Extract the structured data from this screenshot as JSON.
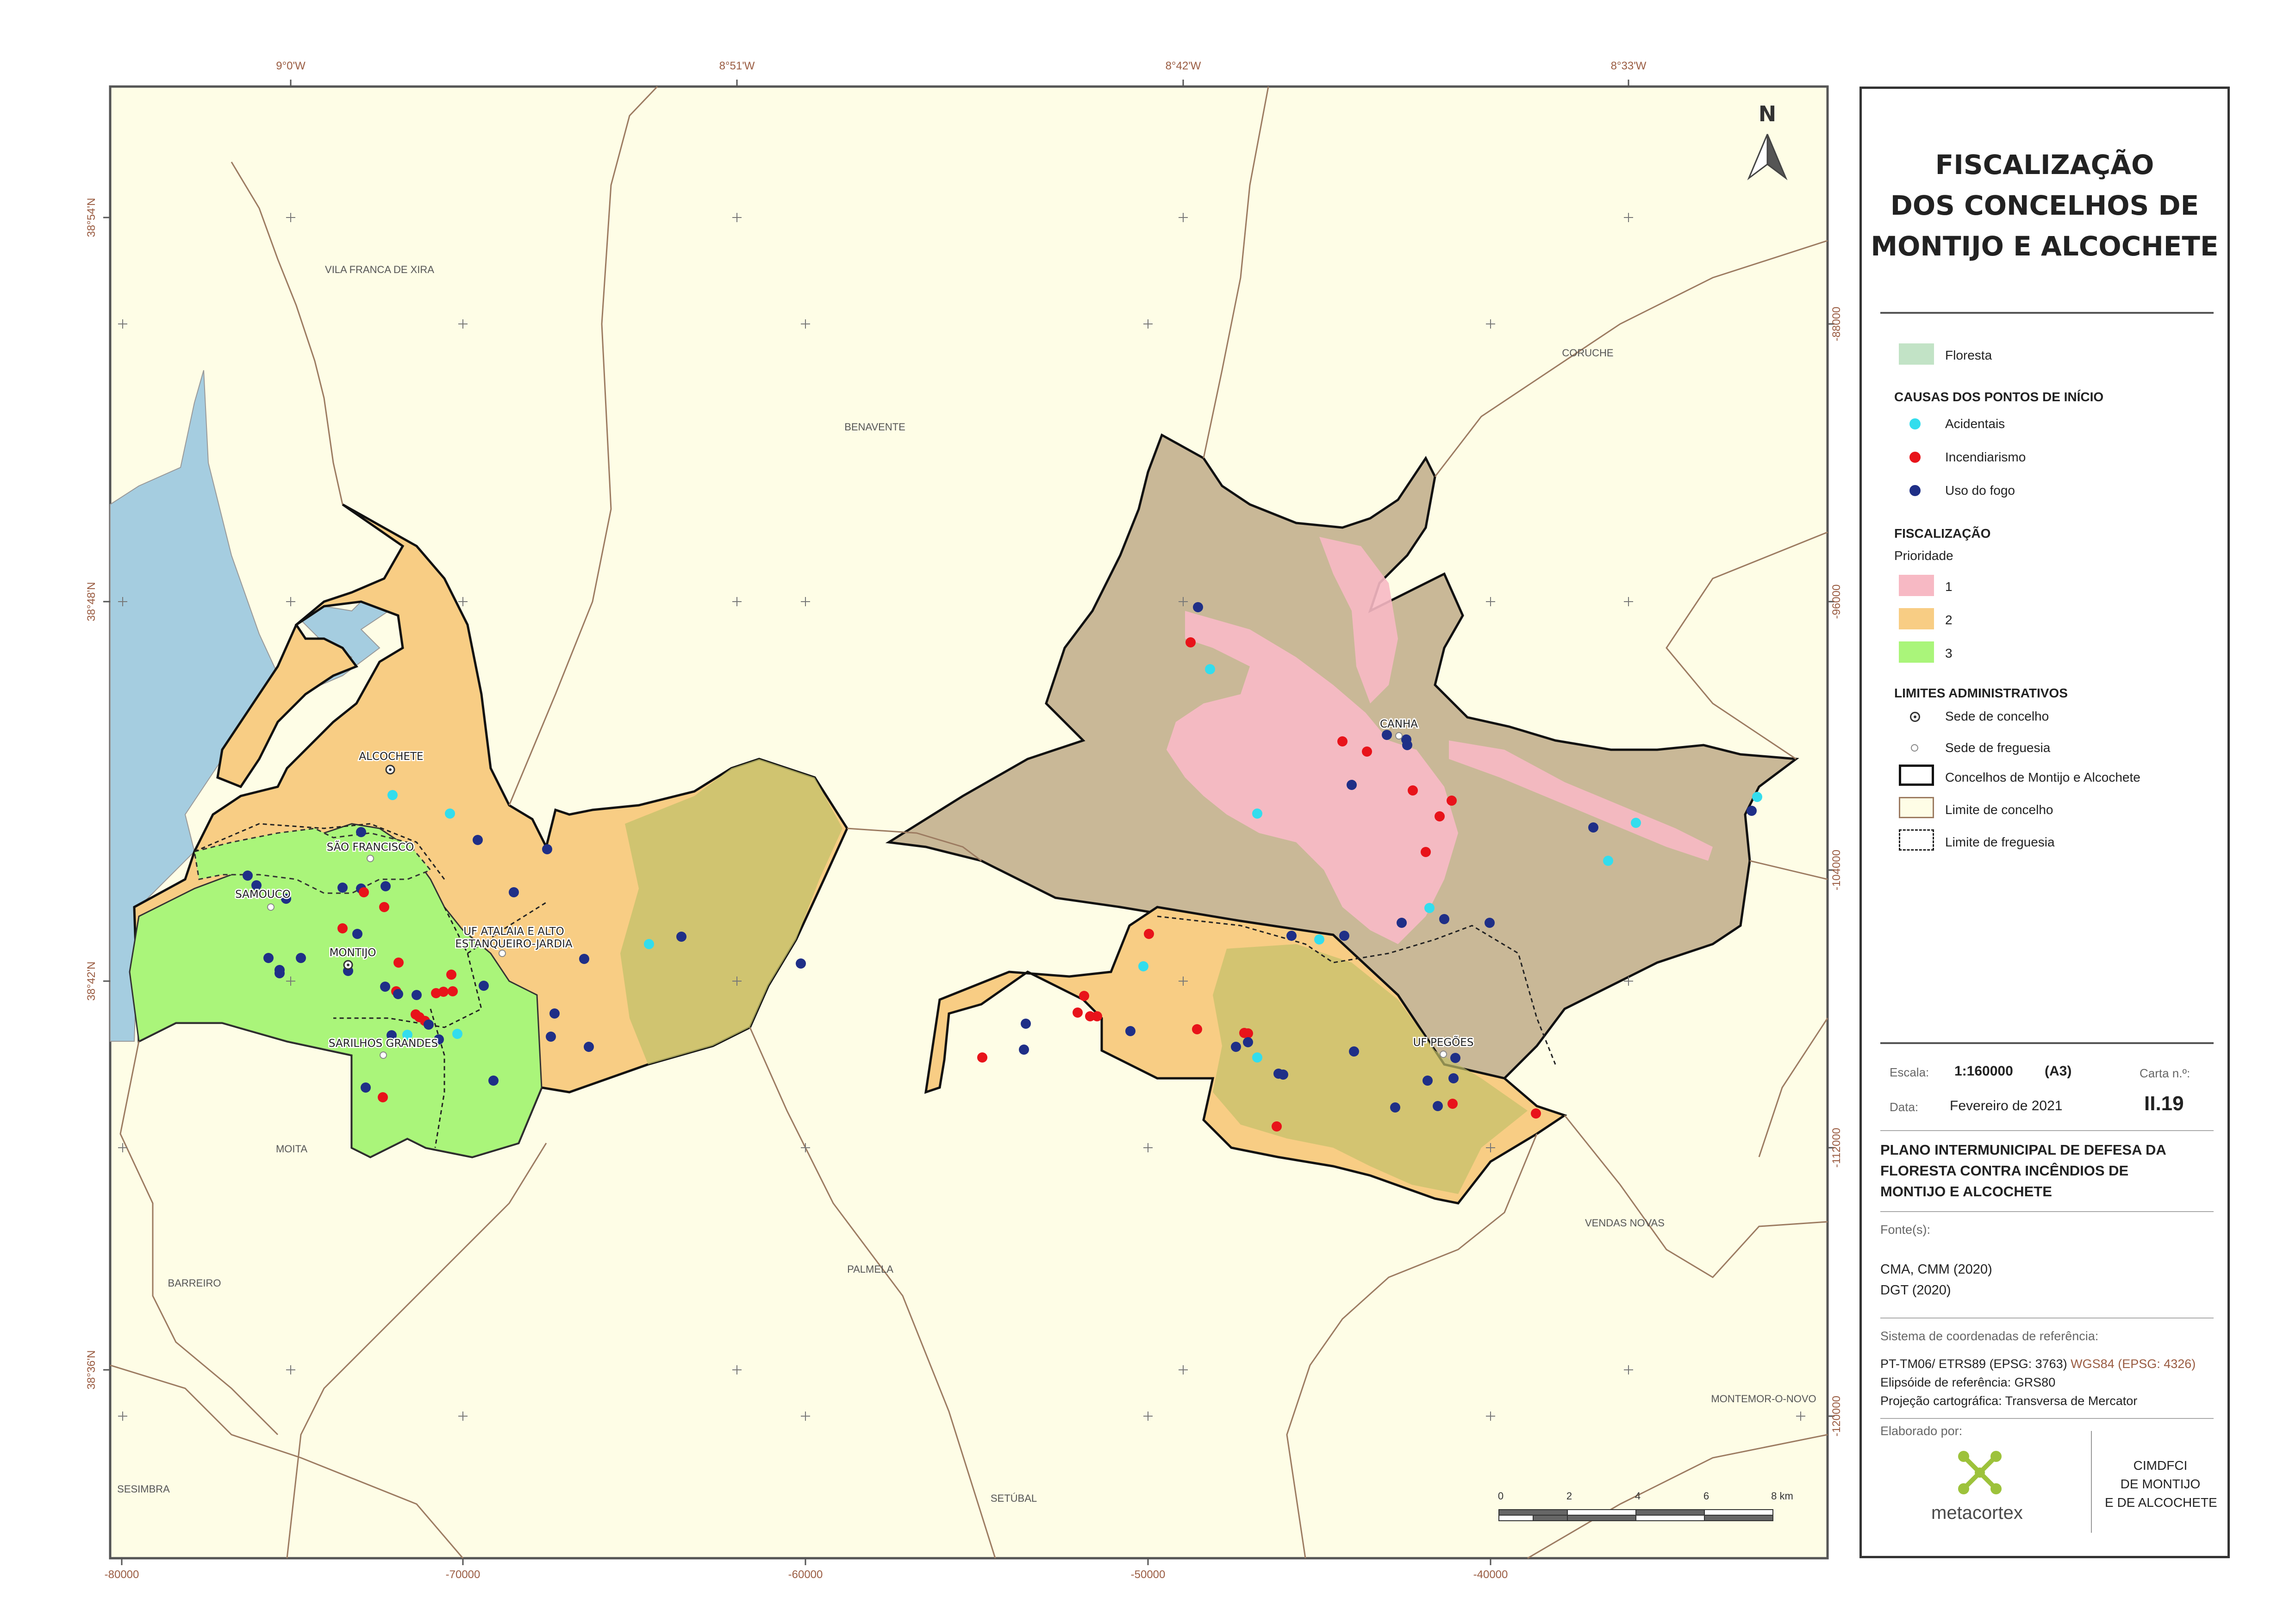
{
  "map": {
    "top_ticks": [
      "9°0'W",
      "8°51'W",
      "8°42'W",
      "8°33'W"
    ],
    "bottom_ticks": [
      "-80000",
      "-70000",
      "-60000",
      "-50000",
      "-40000"
    ],
    "left_ticks": [
      "38°54'N",
      "38°48'N",
      "38°42'N",
      "38°36'N"
    ],
    "right_ticks": [
      "-88000",
      "-96000",
      "-104000",
      "-112000",
      "-120000"
    ],
    "municipalities": [
      "VILA FRANCA DE XIRA",
      "BENAVENTE",
      "CORUCHE",
      "MOITA",
      "PALMELA",
      "VENDAS NOVAS",
      "BARREIRO",
      "MONTEMOR-O-NOVO",
      "SESIMBRA",
      "SETÚBAL"
    ],
    "places": {
      "alcochete": "ALCOCHETE",
      "sao_francisco": "SÃO FRANCISCO",
      "samouco": "SAMOUCO",
      "montijo": "MONTIJO",
      "atalaia_1": "UF ATALAIA E ALTO",
      "atalaia_2": "ESTANQUEIRO-JARDIA",
      "sarilhos": "SARILHOS GRANDES",
      "canha": "CANHA",
      "pegoes": "UF PEGÕES"
    },
    "north_label": "N",
    "scale_ticks": [
      "0",
      "2",
      "4",
      "6",
      "8 km"
    ]
  },
  "title": {
    "line1": "FISCALIZAÇÃO",
    "line2": "DOS CONCELHOS DE",
    "line3": "MONTIJO E ALCOCHETE"
  },
  "legend": {
    "floresta": "Floresta",
    "causes_heading": "CAUSAS DOS PONTOS DE INÍCIO",
    "causes": [
      "Acidentais",
      "Incendiarismo",
      "Uso do fogo"
    ],
    "fisc_heading": "FISCALIZAÇÃO",
    "priority_label": "Prioridade",
    "priorities": [
      "1",
      "2",
      "3"
    ],
    "admin_heading": "LIMITES ADMINISTRATIVOS",
    "admin": [
      "Sede de concelho",
      "Sede de freguesia",
      "Concelhos de Montijo e Alcochete",
      "Limite de concelho",
      "Limite de freguesia"
    ]
  },
  "colors": {
    "acidentais": "#33dded",
    "incendiarismo": "#e8131a",
    "uso_do_fogo": "#1f2f87",
    "prioridade_1": "#f7b9c4",
    "prioridade_2": "#f8cd84",
    "prioridade_3": "#aaf57a",
    "floresta": "#c2e3c6",
    "water": "#a5cde0",
    "background": "#fefde6"
  },
  "meta": {
    "escala_label": "Escala:",
    "escala_value": "1:160000",
    "format": "(A3)",
    "carta_label": "Carta n.º:",
    "carta_value": "II.19",
    "data_label": "Data:",
    "data_value": "Fevereiro de 2021"
  },
  "plan": {
    "line1": "PLANO INTERMUNICIPAL DE DEFESA DA",
    "line2": "FLORESTA CONTRA INCÊNDIOS DE",
    "line3": "MONTIJO E ALCOCHETE"
  },
  "sources": {
    "label": "Fonte(s):",
    "line1": "CMA, CMM (2020)",
    "line2": "DGT (2020)"
  },
  "crs": {
    "label": "Sistema de coordenadas de referência:",
    "line1": "PT-TM06/ ETRS89 (EPSG: 3763)",
    "line1_b": "WGS84 (EPSG: 4326)",
    "line2": "Elipsóide de referência: GRS80",
    "line3": "Projeção cartográfica: Transversa de Mercator"
  },
  "credits": {
    "label": "Elaborado por:",
    "logo_text": "metacortex",
    "org1": "CIMDFCI",
    "org2": "DE MONTIJO",
    "org3": "E DE ALCOCHETE"
  }
}
